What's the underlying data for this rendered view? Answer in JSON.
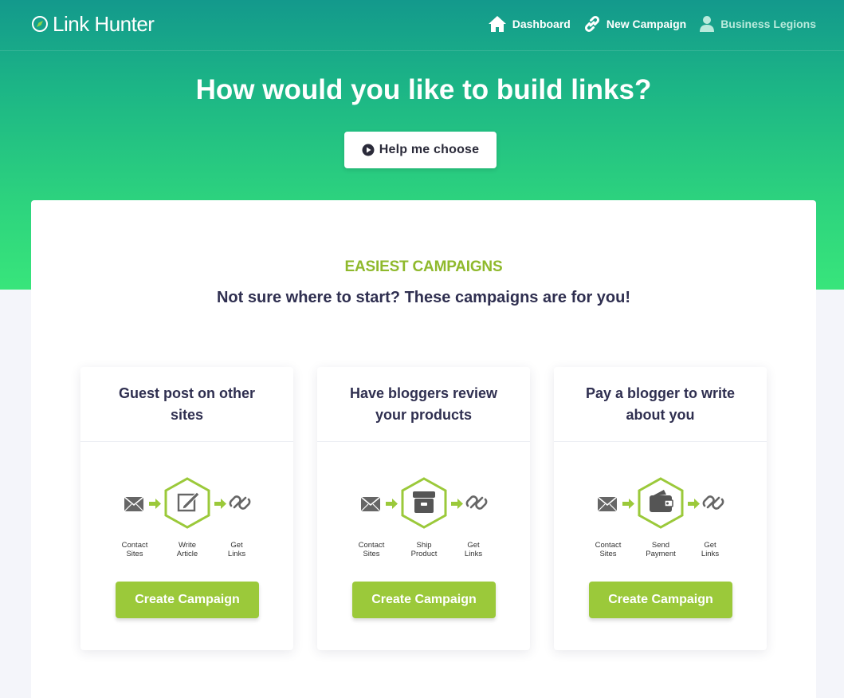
{
  "app": {
    "brand": "Link Hunter",
    "brand_color": "#13998c"
  },
  "nav": {
    "dashboard": "Dashboard",
    "new_campaign": "New Campaign",
    "account": "Business Legions"
  },
  "hero": {
    "headline": "How would you like to build links?",
    "help_button": "Help me choose"
  },
  "section": {
    "label": "EASIEST CAMPAIGNS",
    "subtitle": "Not sure where to start? These campaigns are for you!",
    "label_color": "#8fb92c"
  },
  "cards": [
    {
      "title": "Guest post on other sites",
      "steps": [
        "Contact Sites",
        "Write Article",
        "Get Links"
      ],
      "center_icon": "edit-icon",
      "button": "Create Campaign"
    },
    {
      "title": "Have bloggers review your products",
      "steps": [
        "Contact Sites",
        "Ship Product",
        "Get Links"
      ],
      "center_icon": "archive-box-icon",
      "button": "Create Campaign"
    },
    {
      "title": "Pay a blogger to write about you",
      "steps": [
        "Contact Sites",
        "Send Payment",
        "Get Links"
      ],
      "center_icon": "wallet-icon",
      "button": "Create Campaign"
    }
  ],
  "colors": {
    "button_green": "#9bc93a",
    "hex_green": "#9bc93a",
    "text_dark": "#2f2f50"
  }
}
